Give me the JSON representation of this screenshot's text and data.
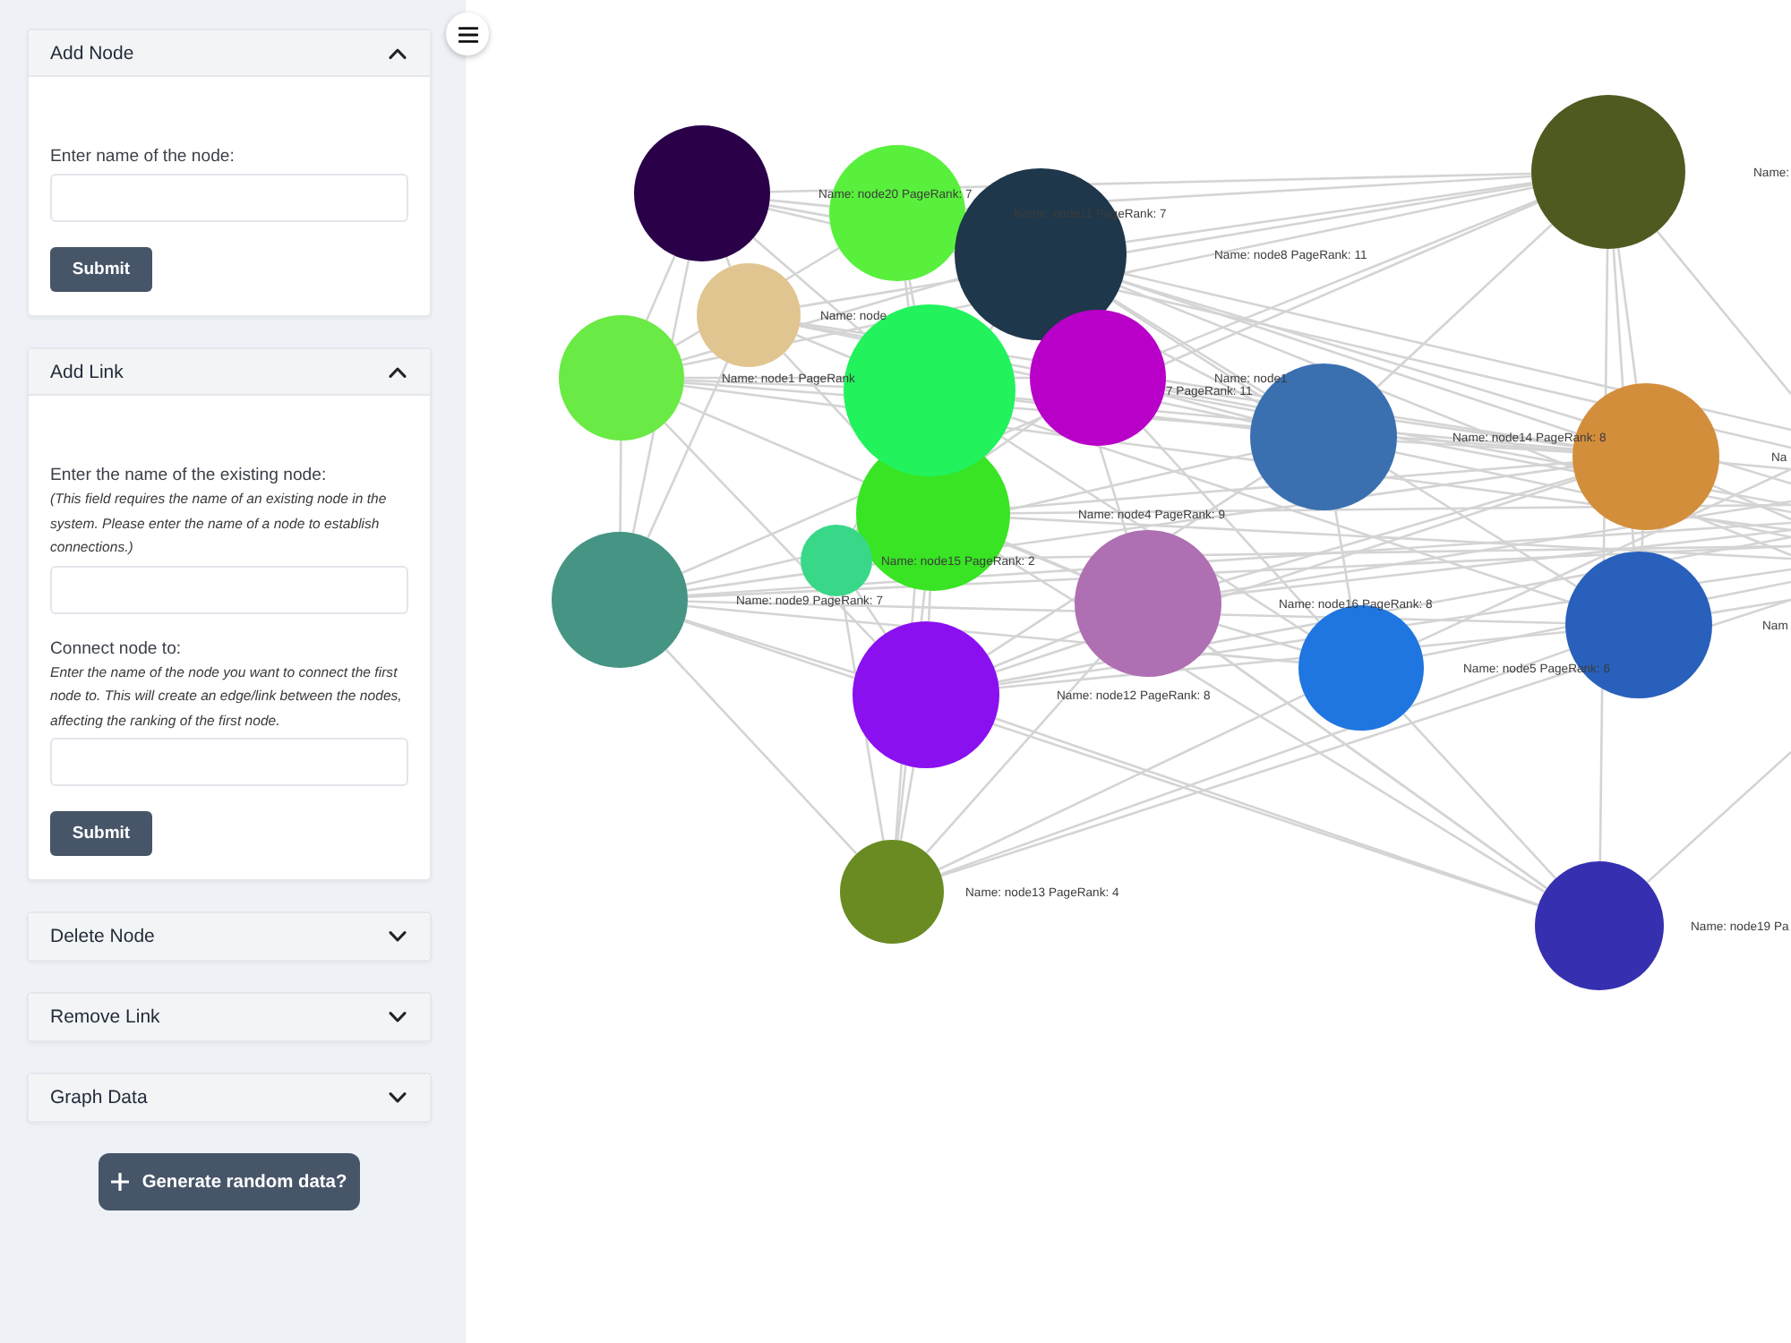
{
  "sidebar": {
    "panels": [
      {
        "title": "Add Node",
        "expanded": true,
        "fields": [
          {
            "label": "Enter name of the node:"
          }
        ],
        "submit": "Submit"
      },
      {
        "title": "Add Link",
        "expanded": true,
        "fields": [
          {
            "label": "Enter the name of the existing node:",
            "hint": "(This field requires the name of an existing node in the system. Please enter the name of a node to establish connections.)"
          },
          {
            "label": "Connect node to:",
            "hint": "Enter the name of the node you want to connect the first node to. This will create an edge/link between the nodes, affecting the ranking of the first node."
          }
        ],
        "submit": "Submit"
      },
      {
        "title": "Delete Node",
        "expanded": false
      },
      {
        "title": "Remove Link",
        "expanded": false
      },
      {
        "title": "Graph Data",
        "expanded": false
      }
    ],
    "generate_button": "Generate random data?"
  },
  "graph": {
    "nodes": [
      {
        "color": "#4e5a20",
        "label": "Name:"
      },
      {
        "color": "#2a0049",
        "label": "Name: node20 PageRank: 7"
      },
      {
        "color": "#58f03c",
        "label": "Name: node11 PageRank: 7"
      },
      {
        "color": "#1f374b",
        "label": "Name: node8 PageRank: 11"
      },
      {
        "color": "#e1c591",
        "label": "Name: node"
      },
      {
        "color": "#6aea44",
        "label": "Name: node1 PageRank"
      },
      {
        "color": "#b800c8",
        "label": "Name: node1"
      },
      {
        "color": "#22f25c",
        "label": "7 PageRank: 11"
      },
      {
        "color": "#3a70b0",
        "label": "Name: node14 PageRank: 8"
      },
      {
        "color": "#d38e3c",
        "label": "Na"
      },
      {
        "color": "#38e424",
        "label": "Name: node4 PageRank: 9"
      },
      {
        "color": "#38d888",
        "label": "Name: node15 PageRank: 2"
      },
      {
        "color": "#459484",
        "label": "Name: node9 PageRank: 7"
      },
      {
        "color": "#ae70b2",
        "label": "Name: node16 PageRank: 8"
      },
      {
        "color": "#2860bc",
        "label": "Nam"
      },
      {
        "color": "#2076e0",
        "label": "Name: node5 PageRank: 6"
      },
      {
        "color": "#8a10f0",
        "label": "Name: node12 PageRank: 8"
      },
      {
        "color": "#6a8a22",
        "label": "Name: node13 PageRank: 4"
      },
      {
        "color": "#3630b0",
        "label": "Name: node19 Pa"
      }
    ]
  }
}
